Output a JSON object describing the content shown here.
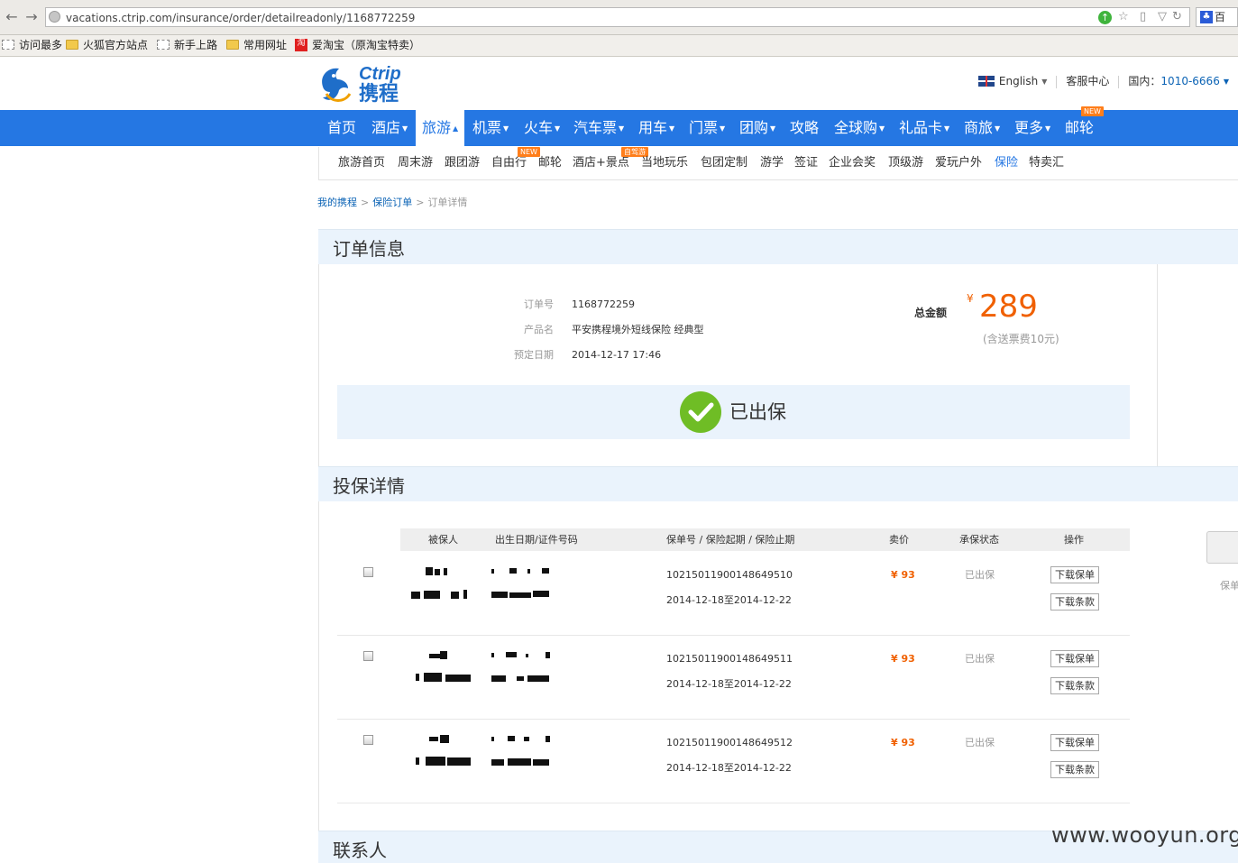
{
  "browser": {
    "url": "vacations.ctrip.com/insurance/order/detailreadonly/1168772259",
    "search_partial": "百",
    "bookmarks": [
      "访问最多",
      "火狐官方站点",
      "新手上路",
      "常用网址",
      "爱淘宝（原淘宝特卖）"
    ]
  },
  "header": {
    "logo_text": "Ctrip",
    "logo_cn": "携程",
    "language": "English",
    "service": "客服中心",
    "phone_label": "国内：",
    "phone": "1010-6666"
  },
  "main_nav": [
    "首页",
    "酒店",
    "旅游",
    "机票",
    "火车",
    "汽车票",
    "用车",
    "门票",
    "团购",
    "攻略",
    "全球购",
    "礼品卡",
    "商旅",
    "更多",
    "邮轮"
  ],
  "main_nav_badge": "NEW",
  "sub_nav": [
    "旅游首页",
    "周末游",
    "跟团游",
    "自由行",
    "邮轮",
    "酒店+景点",
    "当地玩乐",
    "包团定制",
    "游学",
    "签证",
    "企业会奖",
    "顶级游",
    "爱玩户外",
    "保险",
    "特卖汇"
  ],
  "sub_nav_badges": {
    "new": "NEW",
    "self_drive": "自驾游"
  },
  "breadcrumb": [
    "我的携程",
    "保险订单",
    "订单详情"
  ],
  "order": {
    "section_title": "订单信息",
    "order_no_label": "订单号",
    "order_no": "1168772259",
    "product_label": "产品名",
    "product": "平安携程境外短线保险 经典型",
    "date_label": "预定日期",
    "date": "2014-12-17 17:46",
    "total_label": "总金额",
    "currency": "¥",
    "total": "289",
    "total_note": "(含送票费10元)",
    "status": "已出保"
  },
  "policy": {
    "section_title": "投保详情",
    "columns": [
      "被保人",
      "出生日期/证件号码",
      "保单号 / 保险起期 / 保险止期",
      "卖价",
      "承保状态",
      "操作"
    ],
    "rows": [
      {
        "policy_no": "10215011900148649510",
        "period": "2014-12-18至2014-12-22",
        "price": "¥ 93",
        "status": "已出保",
        "btn1": "下载保单",
        "btn2": "下载条款"
      },
      {
        "policy_no": "10215011900148649511",
        "period": "2014-12-18至2014-12-22",
        "price": "¥ 93",
        "status": "已出保",
        "btn1": "下载保单",
        "btn2": "下载条款"
      },
      {
        "policy_no": "10215011900148649512",
        "period": "2014-12-18至2014-12-22",
        "price": "¥ 93",
        "status": "已出保",
        "btn1": "下载保单",
        "btn2": "下载条款"
      }
    ],
    "side_note": "保单"
  },
  "contact": {
    "section_title": "联系人"
  },
  "watermark": "www.wooyun.org",
  "colors": {
    "nav_blue": "#2577e3",
    "price_orange": "#f06000",
    "status_green": "#6fbd25",
    "panel_bg": "#eaf3fc"
  }
}
